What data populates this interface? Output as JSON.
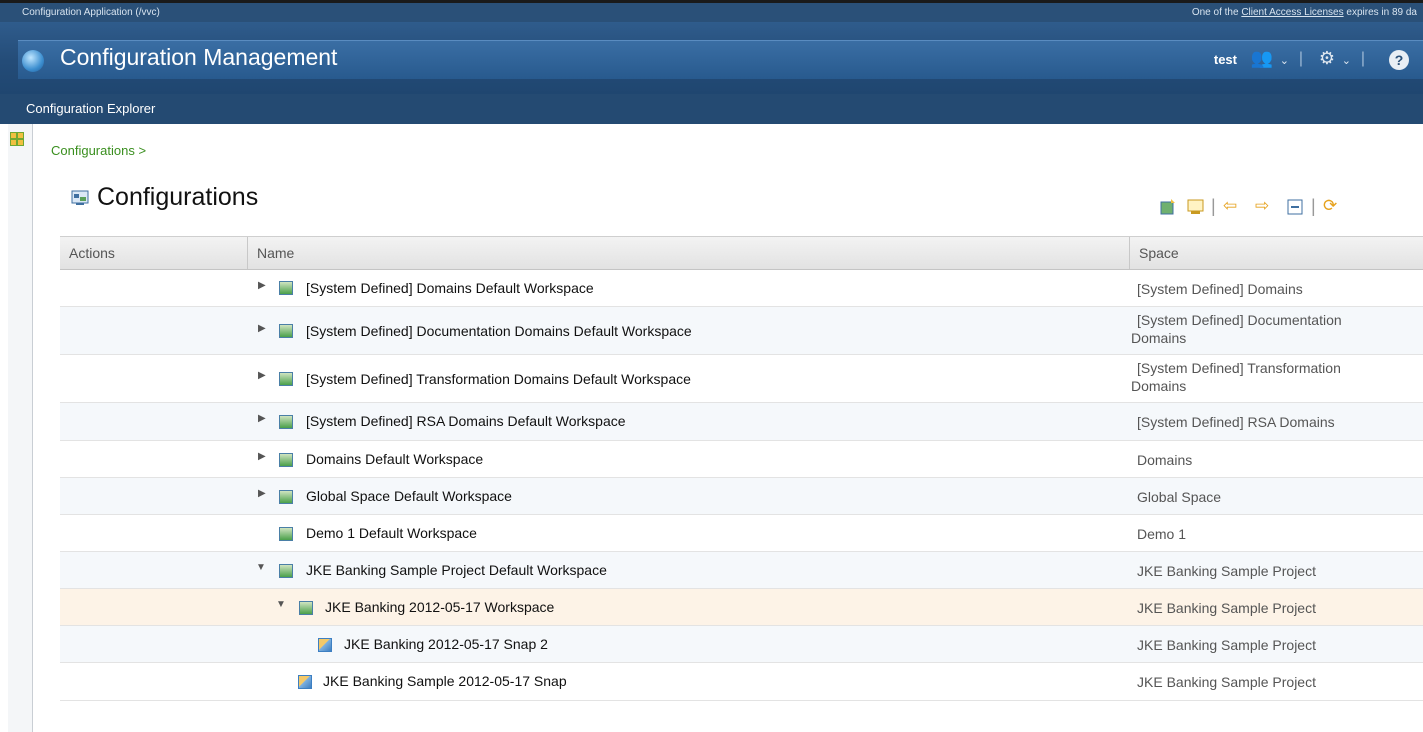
{
  "app_bar": {
    "left_text": "Configuration Application (/vvc)",
    "right_prefix": "One of the ",
    "right_link": "Client Access Licenses",
    "right_suffix": " expires in 89 da"
  },
  "banner": {
    "title": "Configuration Management",
    "user": "test"
  },
  "explorer_label": "Configuration Explorer",
  "breadcrumb": "Configurations >",
  "section_title": "Configurations",
  "table": {
    "headers": {
      "actions": "Actions",
      "name": "Name",
      "space": "Space"
    },
    "rows": [
      {
        "name": "[System Defined] Domains Default Workspace",
        "space": "[System Defined] Domains"
      },
      {
        "name": "[System Defined] Documentation Domains Default Workspace",
        "space_line1": "[System Defined] Documentation",
        "space_line2": "Domains"
      },
      {
        "name": "[System Defined] Transformation Domains Default Workspace",
        "space_line1": "[System Defined] Transformation",
        "space_line2": "Domains"
      },
      {
        "name": "[System Defined] RSA Domains Default Workspace",
        "space": "[System Defined] RSA Domains"
      },
      {
        "name": "Domains Default Workspace",
        "space": "Domains"
      },
      {
        "name": "Global Space Default Workspace",
        "space": "Global Space"
      },
      {
        "name": "Demo 1 Default Workspace",
        "space": "Demo 1"
      },
      {
        "name": "JKE Banking Sample Project Default Workspace",
        "space": "JKE Banking Sample Project"
      },
      {
        "name": "JKE Banking 2012-05-17 Workspace",
        "space": "JKE Banking Sample Project"
      },
      {
        "name": "JKE Banking 2012-05-17 Snap 2",
        "space": "JKE Banking Sample Project"
      },
      {
        "name": "JKE Banking Sample 2012-05-17 Snap",
        "space": "JKE Banking Sample Project"
      }
    ]
  }
}
